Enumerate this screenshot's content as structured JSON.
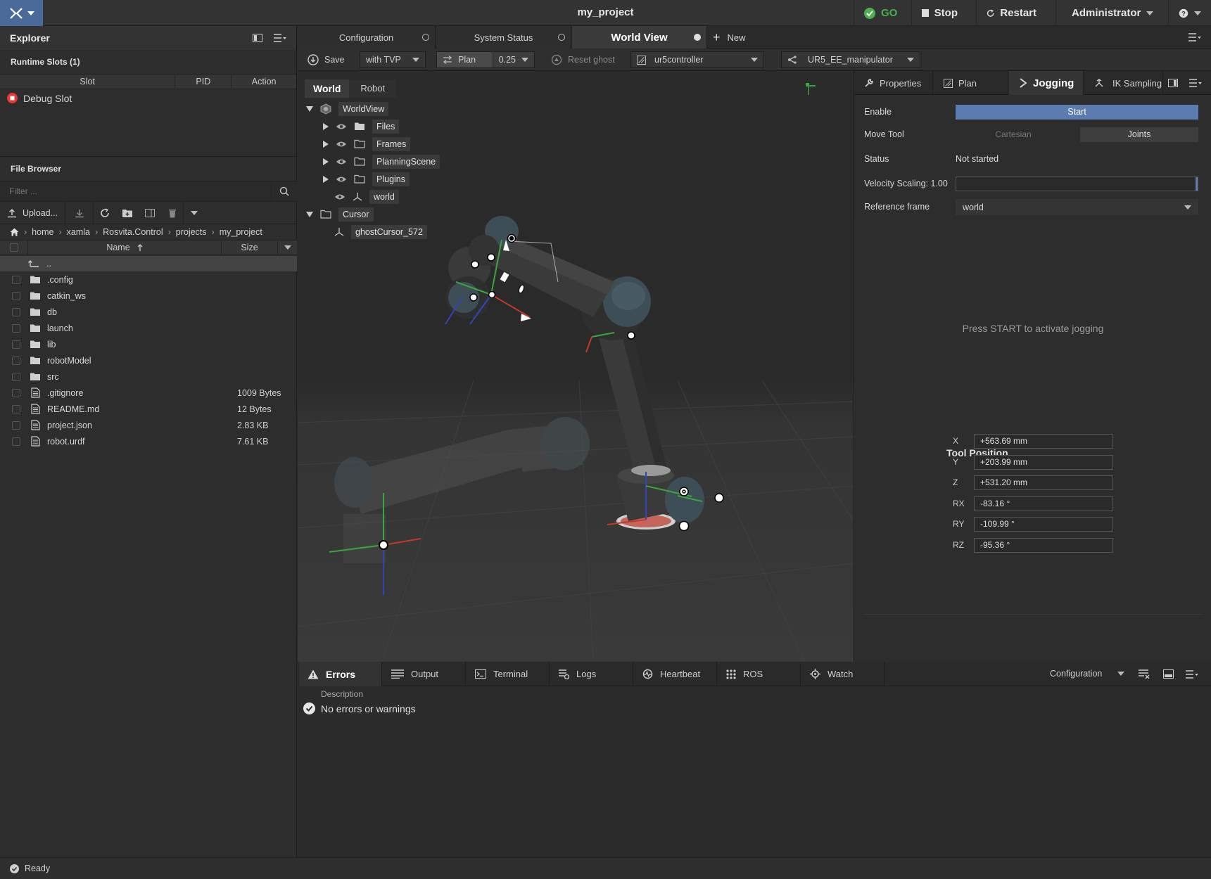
{
  "app": {
    "project_title": "my_project"
  },
  "topbar": {
    "go_label": "GO",
    "stop_label": "Stop",
    "restart_label": "Restart",
    "user_label": "Administrator"
  },
  "explorer": {
    "title": "Explorer",
    "runtime_slots_title": "Runtime Slots (1)",
    "columns": [
      "Slot",
      "PID",
      "Action"
    ],
    "slots": [
      {
        "name": "Debug Slot"
      }
    ]
  },
  "file_browser": {
    "title": "File Browser",
    "filter_placeholder": "Filter ...",
    "upload_label": "Upload...",
    "breadcrumb": [
      "home",
      "xamla",
      "Rosvita.Control",
      "projects",
      "my_project"
    ],
    "col_name": "Name",
    "col_size": "Size",
    "parent_label": "..",
    "items": [
      {
        "name": ".config",
        "type": "folder",
        "size": ""
      },
      {
        "name": "catkin_ws",
        "type": "folder",
        "size": ""
      },
      {
        "name": "db",
        "type": "folder",
        "size": ""
      },
      {
        "name": "launch",
        "type": "folder",
        "size": ""
      },
      {
        "name": "lib",
        "type": "folder",
        "size": ""
      },
      {
        "name": "robotModel",
        "type": "folder",
        "size": ""
      },
      {
        "name": "src",
        "type": "folder",
        "size": ""
      },
      {
        "name": ".gitignore",
        "type": "file",
        "size": "1009 Bytes"
      },
      {
        "name": "README.md",
        "type": "file",
        "size": "12 Bytes"
      },
      {
        "name": "project.json",
        "type": "file",
        "size": "2.83 KB"
      },
      {
        "name": "robot.urdf",
        "type": "file",
        "size": "7.61 KB"
      }
    ]
  },
  "tabs": {
    "configuration": "Configuration",
    "system_status": "System Status",
    "world_view": "World View",
    "new": "New"
  },
  "toolbar": {
    "save": "Save",
    "tvp": "with TVP",
    "plan": "Plan",
    "plan_value": "0.25",
    "reset_ghost": "Reset ghost",
    "controller": "ur5controller",
    "manipulator": "UR5_EE_manipulator"
  },
  "world_tree": {
    "tab_world": "World",
    "tab_robot": "Robot",
    "root": "WorldView",
    "children": [
      "Files",
      "Frames",
      "PlanningScene",
      "Plugins"
    ],
    "world_frame": "world",
    "cursor": "Cursor",
    "cursor_child": "ghostCursor_572"
  },
  "jogging": {
    "tabs": {
      "properties": "Properties",
      "plan": "Plan",
      "jogging": "Jogging",
      "ik": "IK Sampling"
    },
    "enable_label": "Enable",
    "start_label": "Start",
    "move_tool_label": "Move Tool",
    "cartesian_label": "Cartesian",
    "joints_label": "Joints",
    "status_label": "Status",
    "status_value": "Not started",
    "velocity_label": "Velocity Scaling: 1.00",
    "velocity_fraction": 1.0,
    "ref_frame_label": "Reference frame",
    "ref_frame_value": "world",
    "hint": "Press START to activate jogging",
    "tool_position_title": "Tool Position",
    "position": [
      {
        "axis": "X",
        "value": "+563.69 mm"
      },
      {
        "axis": "Y",
        "value": "+203.99 mm"
      },
      {
        "axis": "Z",
        "value": "+531.20 mm"
      },
      {
        "axis": "RX",
        "value": "-83.16 °"
      },
      {
        "axis": "RY",
        "value": "-109.99 °"
      },
      {
        "axis": "RZ",
        "value": "-95.36 °"
      }
    ]
  },
  "bottom": {
    "tabs": [
      "Errors",
      "Output",
      "Terminal",
      "Logs",
      "Heartbeat",
      "ROS",
      "Watch"
    ],
    "config_label": "Configuration",
    "description_header": "Description",
    "message": "No errors or warnings"
  },
  "status": {
    "text": "Ready"
  }
}
